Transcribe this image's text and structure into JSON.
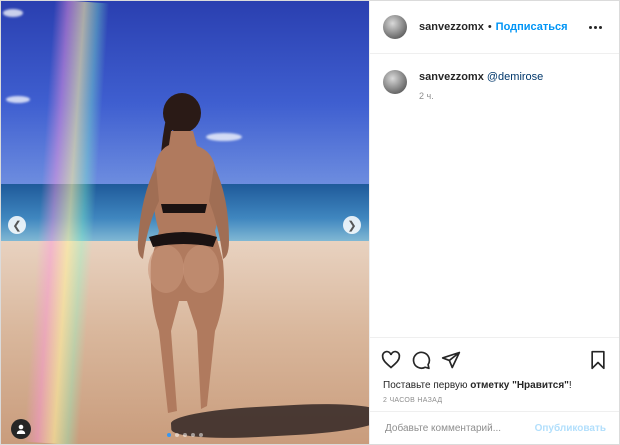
{
  "post": {
    "username": "sanvezzomx",
    "separator": "•",
    "follow_label": "Подписаться",
    "more_icon": "more-horizontal-icon"
  },
  "caption": {
    "username": "sanvezzomx",
    "mention": "@demirose",
    "time": "2 ч."
  },
  "actions": {
    "like_icon": "heart-icon",
    "comment_icon": "comment-icon",
    "share_icon": "send-icon",
    "save_icon": "bookmark-icon"
  },
  "likes": {
    "prefix": "Поставьте первую ",
    "bold": "отметку \"Нравится\"",
    "suffix": "!"
  },
  "date_label": "2 ЧАСОВ НАЗАД",
  "comment_box": {
    "placeholder": "Добавьте комментарий...",
    "publish_label": "Опубликовать"
  },
  "carousel": {
    "total": 5,
    "active": 1
  },
  "colors": {
    "link": "#0095f6",
    "publish_disabled": "#b2dffc"
  }
}
